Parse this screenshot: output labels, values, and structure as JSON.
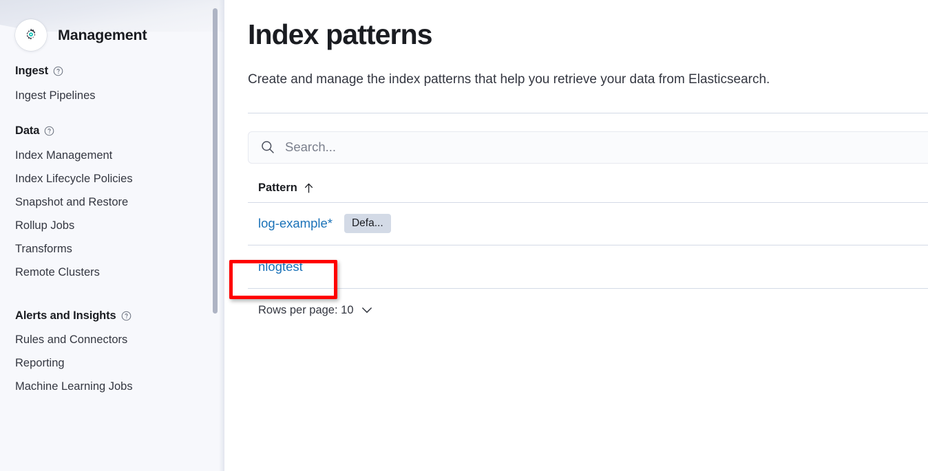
{
  "sidebar": {
    "header": {
      "title": "Management",
      "icon": "gear-icon"
    },
    "groups": [
      {
        "title": "Ingest",
        "help_icon": "question-circle-icon",
        "items": [
          {
            "label": "Ingest Pipelines"
          }
        ]
      },
      {
        "title": "Data",
        "help_icon": "question-circle-icon",
        "items": [
          {
            "label": "Index Management"
          },
          {
            "label": "Index Lifecycle Policies"
          },
          {
            "label": "Snapshot and Restore"
          },
          {
            "label": "Rollup Jobs"
          },
          {
            "label": "Transforms"
          },
          {
            "label": "Remote Clusters"
          }
        ]
      },
      {
        "title": "Alerts and Insights",
        "help_icon": "question-circle-icon",
        "items": [
          {
            "label": "Rules and Connectors"
          },
          {
            "label": "Reporting"
          },
          {
            "label": "Machine Learning Jobs"
          }
        ]
      }
    ]
  },
  "main": {
    "title": "Index patterns",
    "description": "Create and manage the index patterns that help you retrieve your data from Elasticsearch.",
    "search": {
      "placeholder": "Search...",
      "value": "",
      "icon": "search-icon"
    },
    "table": {
      "columns": [
        {
          "label": "Pattern",
          "sort_icon": "arrow-up-icon",
          "sorted": "asc"
        }
      ],
      "rows": [
        {
          "pattern": "log-example*",
          "badge": "Defa...",
          "highlighted": true
        },
        {
          "pattern": "nlogtest",
          "badge": "",
          "highlighted": false
        }
      ]
    },
    "pagination": {
      "rows_per_page_label": "Rows per page: 10",
      "chevron_icon": "chevron-down-icon"
    }
  },
  "colors": {
    "link": "#1a72b8",
    "accent_teal": "#00BFB3",
    "highlight_red": "#FF0000",
    "sidebar_bg": "#F7F8FC",
    "badge_bg": "#D3DAE6",
    "border": "#D3DAE6"
  }
}
